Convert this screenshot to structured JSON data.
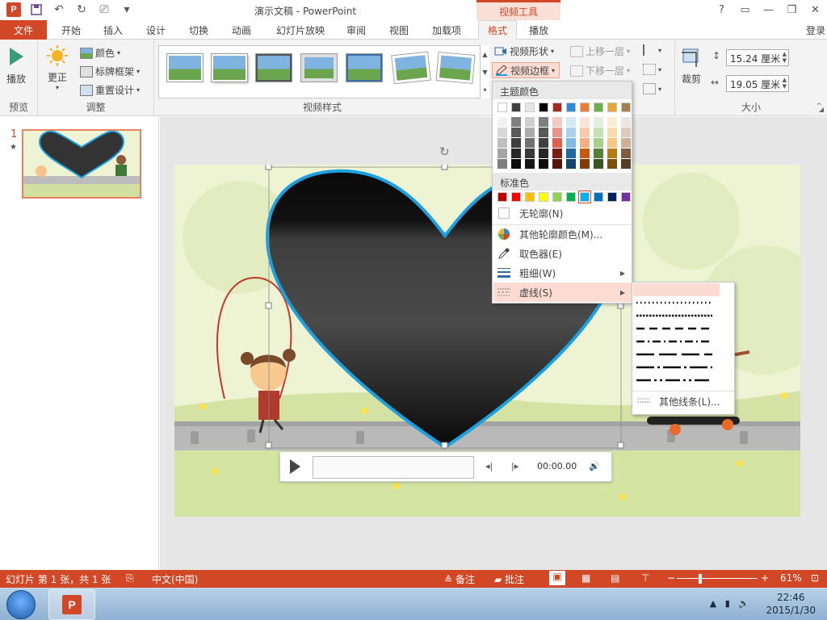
{
  "titlebar": {
    "title": "演示文稿 - PowerPoint",
    "context_tab_group": "视频工具",
    "app_logo": "P",
    "buttons": [
      "?",
      "▭",
      "—",
      "❐",
      "✕"
    ]
  },
  "tabs": {
    "items": [
      "文件",
      "开始",
      "插入",
      "设计",
      "切换",
      "动画",
      "幻灯片放映",
      "审阅",
      "视图",
      "加载项",
      "格式",
      "播放"
    ],
    "active": "格式",
    "login": "登录"
  },
  "ribbon": {
    "preview": {
      "button": "播放",
      "group": "预览"
    },
    "adjust": {
      "correct": "更正",
      "color": "颜色",
      "poster_frame": "标牌框架",
      "reset_design": "重置设计",
      "group": "调整"
    },
    "video_styles": {
      "group": "视频样式"
    },
    "shape_btn": "视频形状",
    "border_btn": "视频边框",
    "arrange": {
      "bring_forward": "上移一层",
      "send_backward": "下移一层"
    },
    "size": {
      "crop": "裁剪",
      "height": "15.24 厘米",
      "width": "19.05 厘米",
      "group": "大小"
    }
  },
  "thumbnails": {
    "slide_number": "1",
    "star": "★"
  },
  "media_bar": {
    "time": "00:00.00"
  },
  "border_menu": {
    "theme_colors_header": "主题颜色",
    "standard_colors_header": "标准色",
    "no_outline": "无轮廓(N)",
    "more_colors": "其他轮廓颜色(M)...",
    "eyedropper": "取色器(E)",
    "weight": "粗细(W)",
    "dashes": "虚线(S)",
    "theme_top_row": [
      "#ffffff",
      "#404040",
      "#e7e6e6",
      "#000000",
      "#a5291f",
      "#2e8bd8",
      "#ec7d31",
      "#6caf48",
      "#e9a531",
      "#a77e52"
    ],
    "theme_shades": [
      [
        "#f2f2f2",
        "#d8d8d8",
        "#bfbfbf",
        "#a5a5a5",
        "#7f7f7f"
      ],
      [
        "#7f7f7f",
        "#595959",
        "#3f3f3f",
        "#262626",
        "#0c0c0c"
      ],
      [
        "#d0cece",
        "#aeaaaa",
        "#757070",
        "#3a3838",
        "#171616"
      ],
      [
        "#7f7f7f",
        "#595959",
        "#3f3f3f",
        "#262626",
        "#0c0c0c"
      ],
      [
        "#f4c9c5",
        "#ea938c",
        "#e05e52",
        "#7b1e16",
        "#52140f"
      ],
      [
        "#d5e8f7",
        "#abd1ef",
        "#81bae7",
        "#1f68a4",
        "#14456d"
      ],
      [
        "#fbe4d5",
        "#f7caac",
        "#f4b083",
        "#c45911",
        "#823b0b"
      ],
      [
        "#e2efda",
        "#c5e0b3",
        "#a8d08d",
        "#538135",
        "#375623"
      ],
      [
        "#fbedd5",
        "#f7dbac",
        "#f4c983",
        "#b57b14",
        "#78520d"
      ],
      [
        "#ede5dc",
        "#dccbba",
        "#cab197",
        "#7d5e3d",
        "#533f28"
      ]
    ],
    "standard_colors": [
      "#c00000",
      "#ff0000",
      "#ffc000",
      "#ffff00",
      "#92d050",
      "#00b050",
      "#00b0f0",
      "#0070c0",
      "#002060",
      "#7030a0"
    ],
    "selected_color": "#00b0f0"
  },
  "dash_menu": {
    "more_lines": "其他线条(L)...",
    "styles": [
      "solid",
      "round-dot",
      "square-dot",
      "dash",
      "dash-dot",
      "long-dash",
      "long-dash-dot",
      "long-dash-dot-dot"
    ]
  },
  "statusbar": {
    "slide_info": "幻灯片 第 1 张，共 1 张",
    "language": "中文(中国)",
    "notes": "备注",
    "comments": "批注",
    "zoom": "61%",
    "minus": "−",
    "plus": "+"
  },
  "taskbar": {
    "time": "22:46",
    "date": "2015/1/30"
  },
  "accent_color": "#d24726",
  "heart_border_color": "#1ba1e2"
}
